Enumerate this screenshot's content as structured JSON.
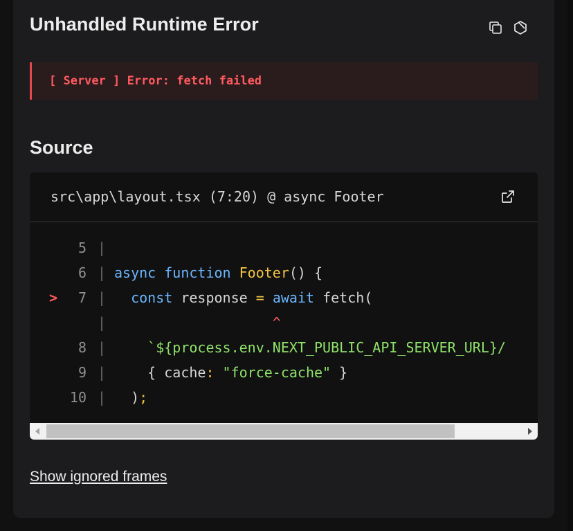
{
  "dialog": {
    "title": "Unhandled Runtime Error",
    "actions": [
      {
        "name": "copy-icon"
      },
      {
        "name": "next-hexagon-icon"
      }
    ],
    "error_message": "[ Server ] Error: fetch failed"
  },
  "source": {
    "heading": "Source",
    "file_path": "src\\app\\layout.tsx (7:20) @ async Footer",
    "open_icon": "external-link-icon",
    "lines": [
      {
        "num": "5",
        "marker": "",
        "sep": "|"
      },
      {
        "num": "6",
        "marker": "",
        "sep": "|",
        "tokens": [
          {
            "t": "async",
            "c": "kw"
          },
          {
            "t": " "
          },
          {
            "t": "function",
            "c": "kw"
          },
          {
            "t": " "
          },
          {
            "t": "Footer",
            "c": "fn"
          },
          {
            "t": "() {"
          }
        ]
      },
      {
        "num": "7",
        "marker": ">",
        "sep": "|",
        "tokens": [
          {
            "t": "  "
          },
          {
            "t": "const",
            "c": "kw"
          },
          {
            "t": " response "
          },
          {
            "t": "=",
            "c": "fn"
          },
          {
            "t": " "
          },
          {
            "t": "await",
            "c": "kw"
          },
          {
            "t": " fetch("
          }
        ]
      },
      {
        "num": "",
        "marker": "",
        "sep": "|",
        "tokens": [
          {
            "t": "                   "
          },
          {
            "t": "^",
            "c": "caret"
          }
        ]
      },
      {
        "num": "8",
        "marker": "",
        "sep": "|",
        "tokens": [
          {
            "t": "    "
          },
          {
            "t": "`${process.env.NEXT_PUBLIC_API_SERVER_URL}/",
            "c": "str"
          }
        ]
      },
      {
        "num": "9",
        "marker": "",
        "sep": "|",
        "tokens": [
          {
            "t": "    { cache"
          },
          {
            "t": ":",
            "c": "fn"
          },
          {
            "t": " "
          },
          {
            "t": "\"force-cache\"",
            "c": "str"
          },
          {
            "t": " }"
          }
        ]
      },
      {
        "num": "10",
        "marker": "",
        "sep": "|",
        "tokens": [
          {
            "t": "  )"
          },
          {
            "t": ";",
            "c": "punc"
          }
        ]
      }
    ]
  },
  "footer": {
    "ignored_frames_label": "Show ignored frames"
  }
}
